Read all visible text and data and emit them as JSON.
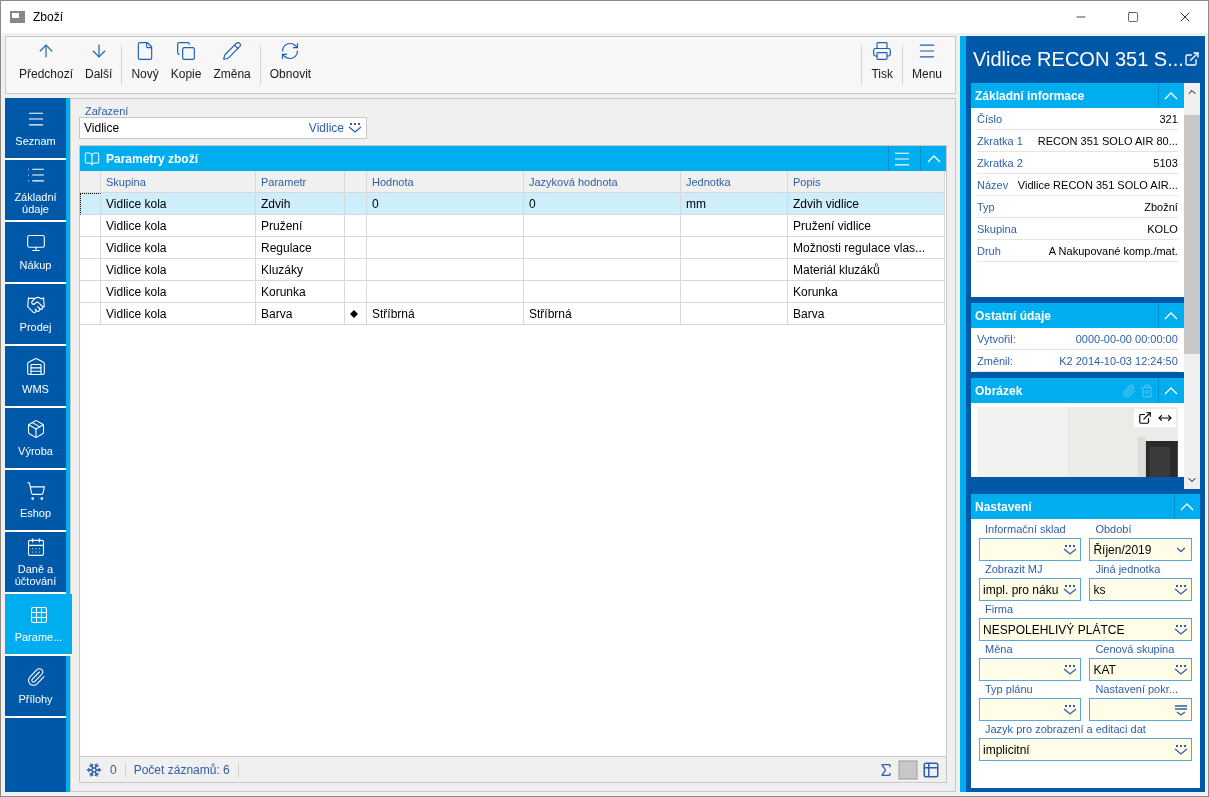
{
  "window": {
    "title": "Zboží"
  },
  "toolbar": {
    "left": [
      [
        {
          "label": "Předchozí"
        },
        {
          "label": "Další"
        }
      ],
      [
        {
          "label": "Nový"
        },
        {
          "label": "Kopie"
        },
        {
          "label": "Změna"
        }
      ],
      [
        {
          "label": "Obnovit"
        }
      ]
    ],
    "right": [
      [
        {
          "label": "Tisk"
        }
      ],
      [
        {
          "label": "Menu"
        }
      ]
    ]
  },
  "nav": [
    {
      "label": "Seznam",
      "selected": false
    },
    {
      "label": "Základní údaje",
      "selected": false
    },
    {
      "label": "Nákup",
      "selected": false
    },
    {
      "label": "Prodej",
      "selected": false
    },
    {
      "label": "WMS",
      "selected": false
    },
    {
      "label": "Výroba",
      "selected": false
    },
    {
      "label": "Eshop",
      "selected": false
    },
    {
      "label": "Daně a účtování",
      "selected": false
    },
    {
      "label": "Parame...",
      "selected": true
    },
    {
      "label": "Přílohy",
      "selected": false
    }
  ],
  "classification": {
    "label": "Zařazení",
    "value": "Vidlice",
    "lookup": "Vidlice"
  },
  "table": {
    "title": "Parametry zboží",
    "columns": [
      "Skupina",
      "Parametr",
      "Hodnota",
      "Jazyková hodnota",
      "Jednotka",
      "Popis"
    ],
    "rows": [
      {
        "selected": true,
        "marked": false,
        "cells": [
          "Vidlice kola",
          "Zdvih",
          "0",
          "0",
          "mm",
          "Zdvih vidlice"
        ]
      },
      {
        "selected": false,
        "marked": false,
        "cells": [
          "Vidlice kola",
          "Pružení",
          "",
          "",
          "",
          "Pružení vidlice"
        ]
      },
      {
        "selected": false,
        "marked": false,
        "cells": [
          "Vidlice kola",
          "Regulace",
          "",
          "",
          "",
          "Možnosti regulace vlas..."
        ]
      },
      {
        "selected": false,
        "marked": false,
        "cells": [
          "Vidlice kola",
          "Kluzáky",
          "",
          "",
          "",
          "Materiál kluzáků"
        ]
      },
      {
        "selected": false,
        "marked": false,
        "cells": [
          "Vidlice kola",
          "Korunka",
          "",
          "",
          "",
          "Korunka"
        ]
      },
      {
        "selected": false,
        "marked": true,
        "cells": [
          "Vidlice kola",
          "Barva",
          "Stříbrná",
          "Stříbrná",
          "",
          "Barva"
        ]
      }
    ]
  },
  "status_bar": {
    "count_a": "0",
    "records": "Počet záznamů: 6"
  },
  "detail": {
    "title": "Vidlice RECON 351 S...",
    "sections": [
      {
        "title": "Základní informace",
        "kind": "plain",
        "rows": [
          {
            "label": "Číslo",
            "value": "321"
          },
          {
            "label": "Zkratka 1",
            "value": "RECON 351 SOLO AIR 80..."
          },
          {
            "label": "Zkratka 2",
            "value": "5103"
          },
          {
            "label": "Název",
            "value": "Vidlice RECON 351 SOLO AIR..."
          },
          {
            "label": "Typ",
            "value": "Zbožní"
          },
          {
            "label": "Skupina",
            "value": "KOLO"
          },
          {
            "label": "Druh",
            "value": "A Nakupované komp./mat."
          }
        ]
      },
      {
        "title": "Ostatní údaje",
        "kind": "link",
        "rows": [
          {
            "label": "Vytvořil:",
            "value": "0000-00-00 00:00:00"
          },
          {
            "label": "Změnil:",
            "value": "K2 2014-10-03 12:24:50"
          }
        ]
      },
      {
        "title": "Obrázek",
        "kind": "picture"
      }
    ]
  },
  "settings": {
    "title": "Nastavení",
    "fields": [
      {
        "label": "Informační sklad",
        "kind": "lookup",
        "wide": false
      },
      {
        "label": "Období",
        "value": "Říjen/2019",
        "kind": "select",
        "wide": false
      },
      {
        "label": "Zobrazit MJ",
        "value": "impl. pro náku",
        "kind": "lookup",
        "wide": false
      },
      {
        "label": "Jiná jednotka",
        "value": "ks",
        "kind": "lookup",
        "wide": false
      },
      {
        "label": "Firma",
        "value": "NESPOLEHLIVÝ PLÁTCE",
        "kind": "lookup",
        "wide": true
      },
      {
        "label": "Měna",
        "kind": "lookup",
        "wide": false
      },
      {
        "label": "Cenová skupina",
        "value": "KAT",
        "kind": "lookup",
        "wide": false
      },
      {
        "label": "Typ plánu",
        "kind": "lookup",
        "wide": false
      },
      {
        "label": "Nastavení pokr...",
        "kind": "list",
        "wide": false
      },
      {
        "label": "Jazyk pro zobrazení a editaci dat",
        "value": "implicitní",
        "kind": "lookup",
        "wide": true
      }
    ]
  }
}
